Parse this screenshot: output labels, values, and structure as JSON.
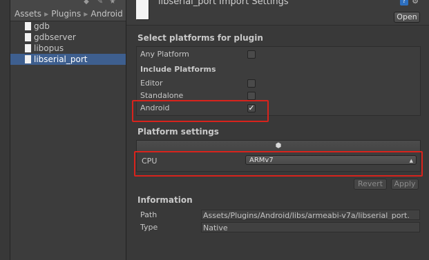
{
  "project": {
    "breadcrumb": [
      "Assets",
      "Plugins",
      "Android"
    ],
    "files": [
      {
        "name": "gdb",
        "selected": false
      },
      {
        "name": "gdbserver",
        "selected": false
      },
      {
        "name": "libopus",
        "selected": false
      },
      {
        "name": "libserial_port",
        "selected": true
      }
    ]
  },
  "inspector": {
    "title": "libserial_port Import Settings",
    "open_label": "Open",
    "select_platforms_label": "Select platforms for plugin",
    "any_platform_label": "Any Platform",
    "any_platform_checked": false,
    "include_platforms_label": "Include Platforms",
    "platforms": [
      {
        "label": "Editor",
        "checked": false
      },
      {
        "label": "Standalone",
        "checked": false
      },
      {
        "label": "Android",
        "checked": true
      }
    ],
    "platform_settings_label": "Platform settings",
    "cpu_label": "CPU",
    "cpu_value": "ARMv7",
    "revert_label": "Revert",
    "apply_label": "Apply",
    "information_label": "Information",
    "path_label": "Path",
    "path_value": "Assets/Plugins/Android/libs/armeabi-v7a/libserial_port.",
    "type_label": "Type",
    "type_value": "Native"
  },
  "icons": {
    "check": "✓",
    "help": "?",
    "gear": "⚙",
    "android": "⬢",
    "breadcrumb_sep": "▶"
  },
  "colors": {
    "highlight": "#d9231c",
    "selection": "#3e5f8f"
  }
}
